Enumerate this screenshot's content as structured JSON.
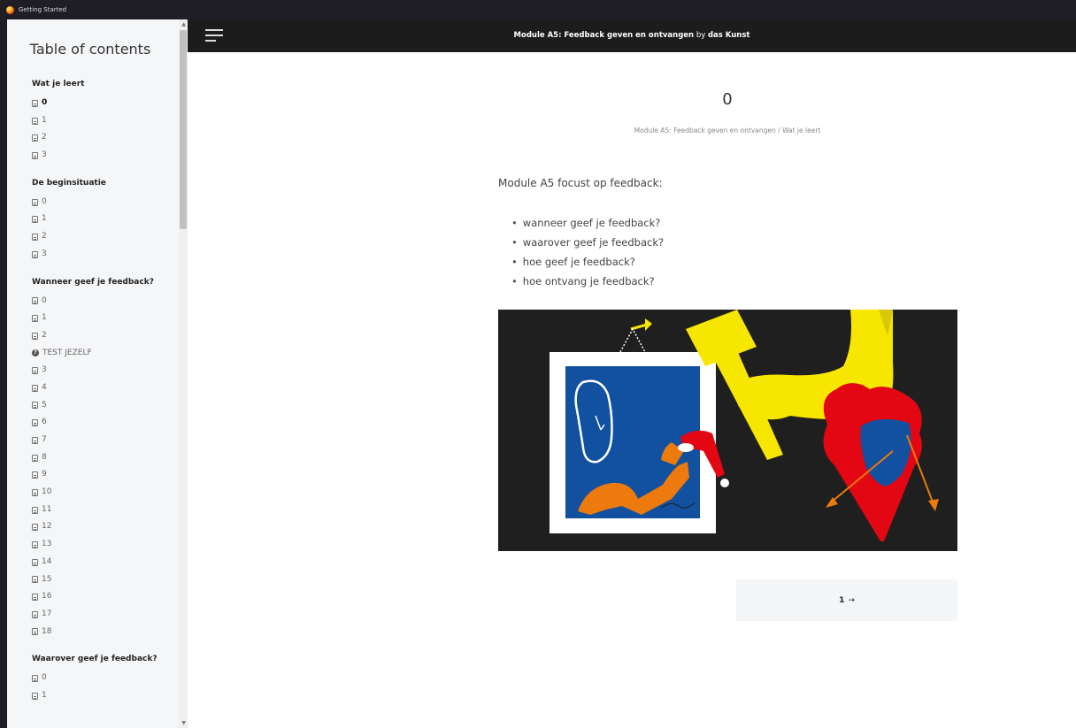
{
  "window": {
    "title": "Getting Started"
  },
  "sidebar": {
    "title": "Table of contents",
    "sections": [
      {
        "title": "Wat je leert",
        "items": [
          "0",
          "1",
          "2",
          "3"
        ],
        "active": 0
      },
      {
        "title": "De beginsituatie",
        "items": [
          "0",
          "1",
          "2",
          "3"
        ]
      },
      {
        "title": "Wanneer geef je feedback?",
        "items": [
          "0",
          "1",
          "2",
          "TEST JEZELF",
          "3",
          "4",
          "5",
          "6",
          "7",
          "8",
          "9",
          "10",
          "11",
          "12",
          "13",
          "14",
          "15",
          "16",
          "17",
          "18"
        ]
      },
      {
        "title": "Waarover geef je feedback?",
        "items": [
          "0",
          "1"
        ]
      }
    ]
  },
  "header": {
    "module_title": "Module A5: Feedback geven en ontvangen",
    "by": "by",
    "author": "das Kunst"
  },
  "main": {
    "page_number": "0",
    "breadcrumb": {
      "module": "Module A5: Feedback geven en ontvangen",
      "separator": "/",
      "section": "Wat je leert"
    },
    "intro": "Module A5 focust op feedback:",
    "bullets": [
      "wanneer geef je feedback?",
      "waarover geef je feedback?",
      "hoe geef je feedback?",
      "hoe ontvang je feedback?"
    ],
    "next": {
      "number": "1",
      "arrow": "→"
    }
  },
  "colors": {
    "header_bg": "#1c1c1c",
    "sidebar_bg": "#f5f6f8",
    "illustration_bg": "#1f1f1f",
    "yellow": "#f7e600",
    "red": "#e30613",
    "blue": "#1250a0",
    "orange": "#ec7a0c"
  }
}
